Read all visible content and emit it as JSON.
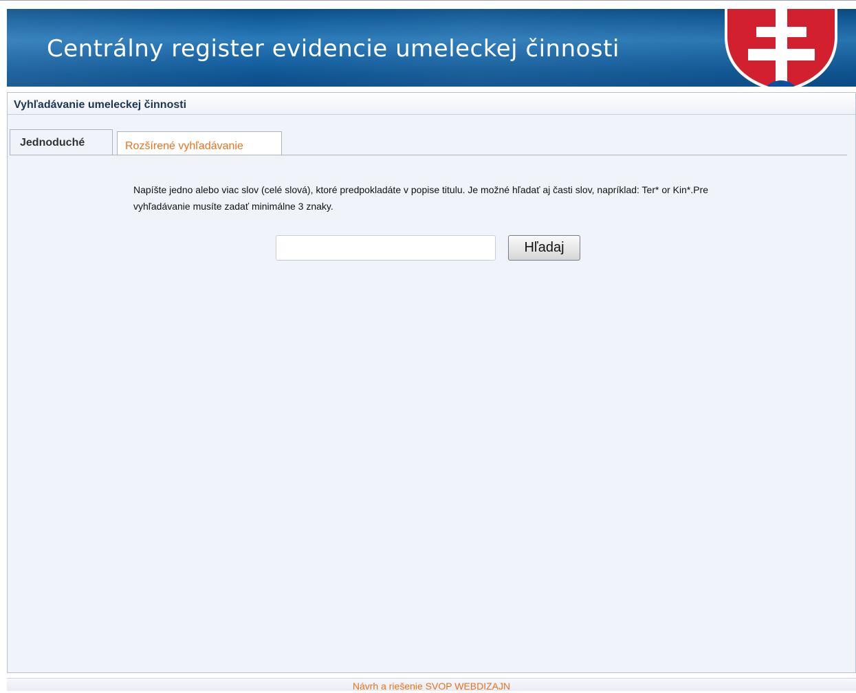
{
  "header": {
    "title": "Centrálny register evidencie umeleckej činnosti",
    "emblem": "slovak-coat-of-arms",
    "colors": {
      "banner": "#1763a2",
      "emblem_red": "#d2202f",
      "emblem_blue": "#0b4ea2"
    }
  },
  "section": {
    "title": "Vyhľadávanie umeleckej činnosti"
  },
  "tabs": [
    {
      "label": "Jednoduché",
      "active": true
    },
    {
      "label": "Rozšírené vyhľadávanie",
      "active": false
    }
  ],
  "search": {
    "hint": "Napíšte jedno alebo viac slov (celé slová), ktoré predpokladáte v popise titulu. Je možné hľadať aj časti slov, napríklad: Ter* or Kin*.Pre vyhľadávanie musíte zadať minimálne 3 znaky.",
    "value": "",
    "button_label": "Hľadaj"
  },
  "footer": {
    "text": "Návrh a riešenie SVOP WEBDIZAJN",
    "link_color": "#e8731e"
  }
}
